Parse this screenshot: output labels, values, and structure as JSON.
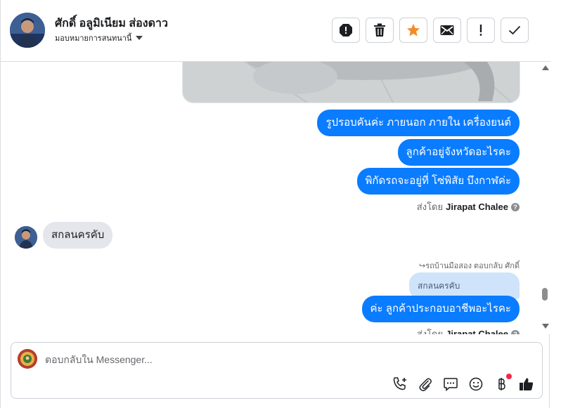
{
  "header": {
    "contact_name": "ศักดิ์ อลูมิเนียม ส่องดาว",
    "assign_label": "มอบหมายการสนทนานี้"
  },
  "toolbar": {
    "buttons": [
      {
        "icon": "spam-icon",
        "label": "Mark as spam"
      },
      {
        "icon": "trash-icon",
        "label": "Delete"
      },
      {
        "icon": "star-icon",
        "label": "Star"
      },
      {
        "icon": "envelope-icon",
        "label": "Mark as unread"
      },
      {
        "icon": "exclamation-icon",
        "label": "Follow up"
      },
      {
        "icon": "check-icon",
        "label": "Mark as done"
      }
    ],
    "star_color": "#f28c28"
  },
  "messages": {
    "outgoing_1": "รูปรอบคันค่ะ ภายนอก ภายใน เครื่องยนต์",
    "outgoing_2": "ลูกค้าอยู่จังหวัดอะไรคะ",
    "outgoing_3": "พิกัดรถจะอยู่ที่ โซ่พิสัย บึงกาฬค่ะ",
    "sent_by_prefix": "ส่งโดย",
    "sent_by_name": "Jirapat Chalee",
    "incoming_1": "สกลนครคับ",
    "reply_note": "รถบ้านมือสอง ตอบกลับ ศักดิ์",
    "quoted_text": "สกลนครคับ",
    "outgoing_4": "ค่ะ ลูกค้าประกอบอาชีพอะไรคะ",
    "sent_by_prefix_2": "ส่งโดย",
    "sent_by_name_2": "Jirapat Chalee"
  },
  "composer": {
    "placeholder": "ตอบกลับใน Messenger...",
    "icons": [
      "phone-plus-icon",
      "paperclip-icon",
      "chat-bubble-icon",
      "emoji-icon",
      "baht-icon",
      "thumbs-up-icon"
    ]
  },
  "colors": {
    "outgoing_bubble": "#0a7cff",
    "incoming_bubble": "#e4e6eb",
    "quoted_bubble": "#cfe3fb",
    "notification_dot": "#f02849"
  }
}
